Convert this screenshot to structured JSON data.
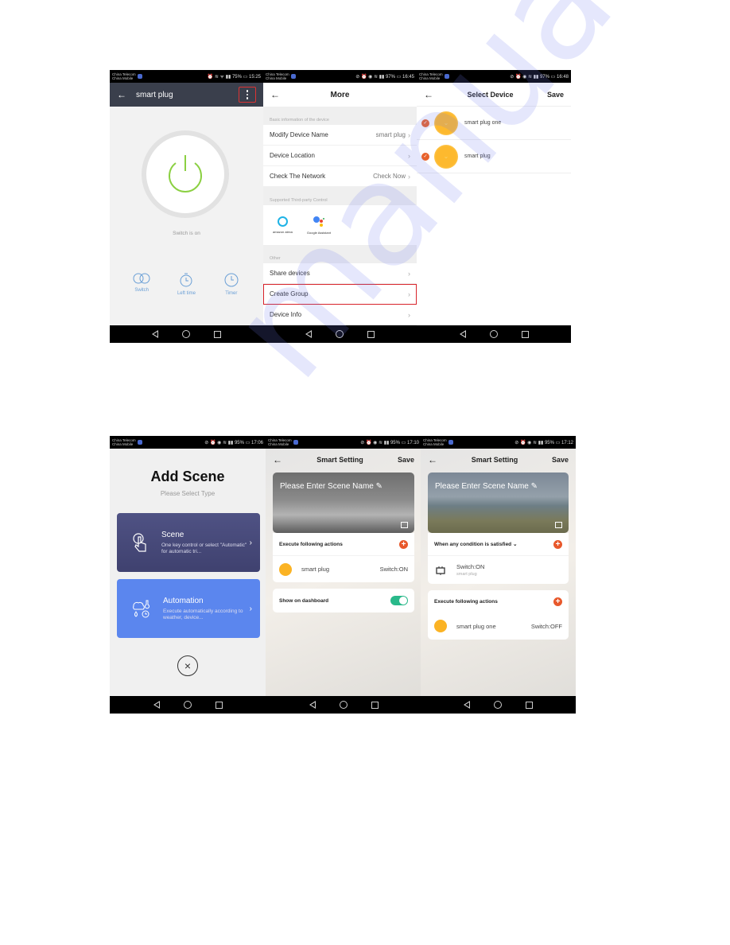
{
  "watermark": "manualshive",
  "screens": {
    "device_control": {
      "status": {
        "carrier1": "China Telecom",
        "carrier2": "China Mobile",
        "right": "⏰ ≋ ᯤ ▮▮ 75% ▭ 15:25"
      },
      "header": {
        "back": "←",
        "title": "smart plug"
      },
      "power_state": "Switch is on",
      "accent": "#8bd042",
      "controls": [
        {
          "label": "Switch",
          "icon": "toggle-icon"
        },
        {
          "label": "Left time",
          "icon": "stopwatch-icon"
        },
        {
          "label": "Timer",
          "icon": "clock-icon"
        }
      ]
    },
    "more": {
      "status": {
        "carrier1": "China Telecom",
        "carrier2": "China Mobile",
        "right": "⊘ ⏰ ◉ ≋ ▮▮ 97% ▭ 16:45"
      },
      "header": {
        "back": "←",
        "title": "More"
      },
      "basic_label": "Basic information of the device",
      "basic_rows": [
        {
          "label": "Modify Device Name",
          "value": "smart plug"
        },
        {
          "label": "Device Location",
          "value": ""
        },
        {
          "label": "Check The Network",
          "value": "Check Now"
        }
      ],
      "third_party_label": "Supported Third-party Control",
      "third_party": [
        {
          "label": "amazon alexa"
        },
        {
          "label": "Google Assistant"
        }
      ],
      "other_label": "Other",
      "other_rows": [
        {
          "label": "Share devices"
        },
        {
          "label": "Create Group"
        },
        {
          "label": "Device Info"
        }
      ],
      "chevron": "›"
    },
    "select_device": {
      "status": {
        "carrier1": "China Telecom",
        "carrier2": "China Mobile",
        "right": "⊘ ⏰ ◉ ≋ ▮▮ 97% ▭ 16:48"
      },
      "header": {
        "back": "←",
        "title": "Select Device",
        "save": "Save"
      },
      "devices": [
        {
          "name": "smart plug one",
          "checked": true
        },
        {
          "name": "smart plug",
          "checked": true
        }
      ],
      "check_mark": "✓"
    },
    "add_scene": {
      "status": {
        "carrier1": "China Telecom",
        "carrier2": "China Mobile",
        "right": "⊘ ⏰ ◉ ≋ ▮▮ 95% ▭ 17:06"
      },
      "title": "Add Scene",
      "subtitle": "Please Select Type",
      "types": [
        {
          "title": "Scene",
          "desc": "One key control or select \"Automatic\" for automatic tri..."
        },
        {
          "title": "Automation",
          "desc": "Execute automatically according to weather, device..."
        }
      ],
      "close": "×"
    },
    "smart_setting_1": {
      "status": {
        "carrier1": "China Telecom",
        "carrier2": "China Mobile",
        "right": "⊘ ⏰ ◉ ≋ ▮▮ 95% ▭ 17:10"
      },
      "header": {
        "back": "←",
        "title": "Smart Setting",
        "save": "Save"
      },
      "scene_name_placeholder": "Please Enter Scene Name ✎",
      "actions_label": "Execute following actions",
      "actions": [
        {
          "device": "smart plug",
          "state": "Switch:ON"
        }
      ],
      "dashboard_label": "Show on dashboard",
      "dashboard_on": true
    },
    "smart_setting_2": {
      "status": {
        "carrier1": "China Telecom",
        "carrier2": "China Mobile",
        "right": "⊘ ⏰ ◉ ≋ ▮▮ 95% ▭ 17:12"
      },
      "header": {
        "back": "←",
        "title": "Smart Setting",
        "save": "Save"
      },
      "scene_name_placeholder": "Please Enter Scene Name ✎",
      "condition_label": "When any condition is satisfied ⌄",
      "conditions": [
        {
          "state": "Switch:ON",
          "device": "smart plug"
        }
      ],
      "actions_label": "Execute following actions",
      "actions": [
        {
          "device": "smart plug one",
          "state": "Switch:OFF"
        }
      ]
    }
  },
  "colors": {
    "accent_orange": "#e8582b",
    "toggle_green": "#29b98a",
    "highlight_red": "#d8232a",
    "scene_card": "#4a4c7c",
    "automation_card": "#5b86ee"
  }
}
